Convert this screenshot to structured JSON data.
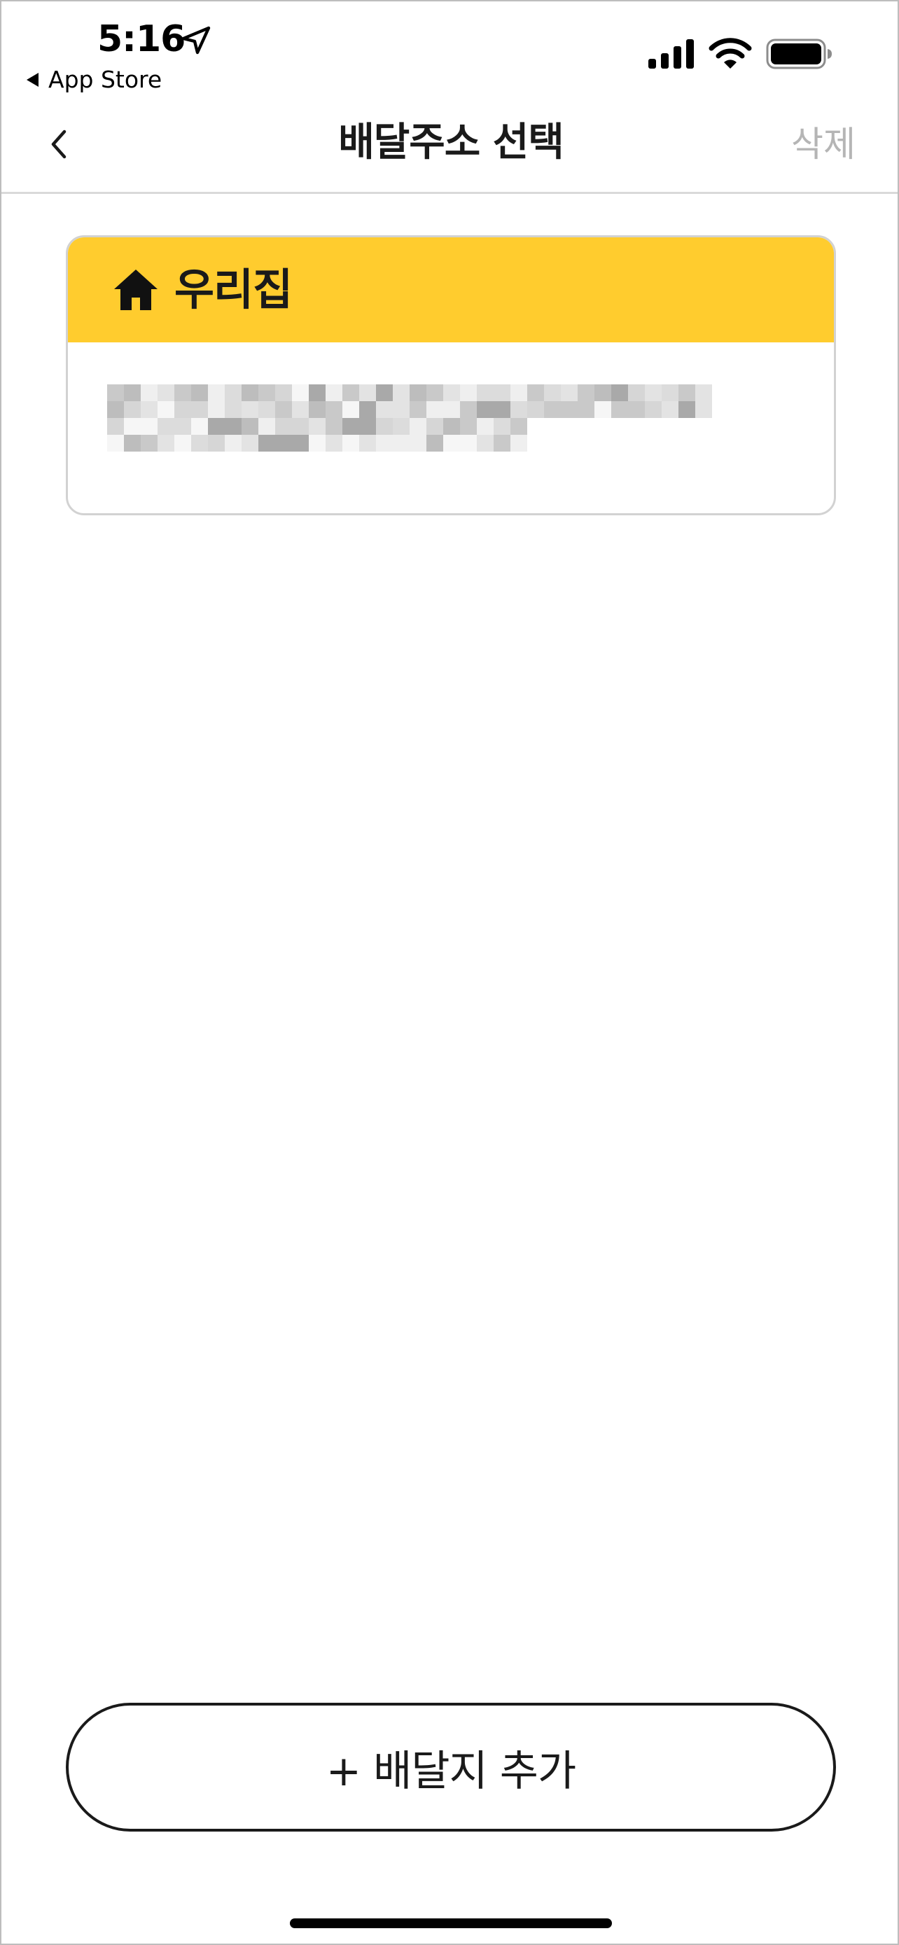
{
  "status_bar": {
    "time": "5:16",
    "back_to_app": "App Store",
    "icons": [
      "location-arrow-icon",
      "cellular-signal-icon",
      "wifi-icon",
      "battery-icon"
    ]
  },
  "nav": {
    "back_icon": "chevron-left-icon",
    "title": "배달주소 선택",
    "delete_label": "삭제"
  },
  "address_card": {
    "icon": "home-icon",
    "name": "우리집",
    "address_redacted": true
  },
  "add_button": {
    "label": "+ 배달지 추가"
  },
  "colors": {
    "accent_yellow": "#ffcc2e",
    "text": "#1a1a1a",
    "muted": "#b5b5b5",
    "divider": "#d9d9d9",
    "card_border": "#d2d2d2"
  }
}
